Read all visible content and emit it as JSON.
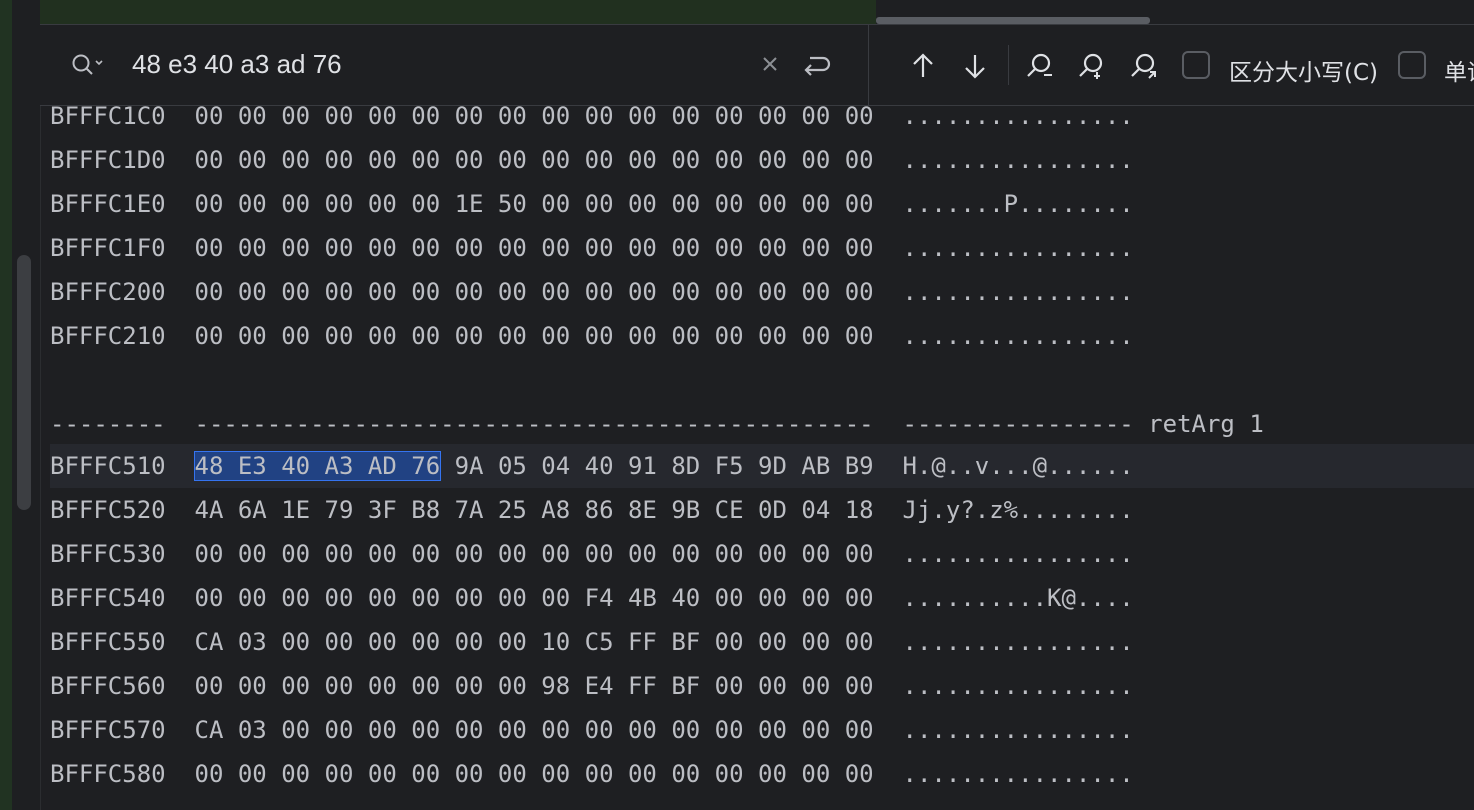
{
  "search": {
    "query": "48 e3 40 a3 ad 76",
    "match_case_label": "区分大小写(C)",
    "words_label": "单词"
  },
  "icons": [
    "search-icon",
    "clear-icon",
    "new-line-icon",
    "arrow-up-icon",
    "arrow-down-icon",
    "filter-icon",
    "select-all-icon",
    "open-in-window-icon"
  ],
  "hex_rows": [
    {
      "addr": "BFFFC1C0",
      "bytes": "00 00 00 00 00 00 00 00 00 00 00 00 00 00 00 00",
      "ascii": "................"
    },
    {
      "addr": "BFFFC1D0",
      "bytes": "00 00 00 00 00 00 00 00 00 00 00 00 00 00 00 00",
      "ascii": "................"
    },
    {
      "addr": "BFFFC1E0",
      "bytes": "00 00 00 00 00 00 1E 50 00 00 00 00 00 00 00 00",
      "ascii": ".......P........"
    },
    {
      "addr": "BFFFC1F0",
      "bytes": "00 00 00 00 00 00 00 00 00 00 00 00 00 00 00 00",
      "ascii": "................"
    },
    {
      "addr": "BFFFC200",
      "bytes": "00 00 00 00 00 00 00 00 00 00 00 00 00 00 00 00",
      "ascii": "................"
    },
    {
      "addr": "BFFFC210",
      "bytes": "00 00 00 00 00 00 00 00 00 00 00 00 00 00 00 00",
      "ascii": "................"
    }
  ],
  "separator": {
    "addr": "--------",
    "bytes": "-----------------------------------------------",
    "ascii": "----------------",
    "label": "retArg 1"
  },
  "highlight": {
    "matched": "48 E3 40 A3 AD 76",
    "rest": " 9A 05 04 40 91 8D F5 9D AB B9"
  },
  "hex_rows2": [
    {
      "addr": "BFFFC510",
      "ascii": "H.@..v...@......"
    },
    {
      "addr": "BFFFC520",
      "bytes": "4A 6A 1E 79 3F B8 7A 25 A8 86 8E 9B CE 0D 04 18",
      "ascii": "Jj.y?.z%........"
    },
    {
      "addr": "BFFFC530",
      "bytes": "00 00 00 00 00 00 00 00 00 00 00 00 00 00 00 00",
      "ascii": "................"
    },
    {
      "addr": "BFFFC540",
      "bytes": "00 00 00 00 00 00 00 00 00 F4 4B 40 00 00 00 00",
      "ascii": "..........K@...."
    },
    {
      "addr": "BFFFC550",
      "bytes": "CA 03 00 00 00 00 00 00 10 C5 FF BF 00 00 00 00",
      "ascii": "................"
    },
    {
      "addr": "BFFFC560",
      "bytes": "00 00 00 00 00 00 00 00 98 E4 FF BF 00 00 00 00",
      "ascii": "................"
    },
    {
      "addr": "BFFFC570",
      "bytes": "CA 03 00 00 00 00 00 00 00 00 00 00 00 00 00 00",
      "ascii": "................"
    },
    {
      "addr": "BFFFC580",
      "bytes": "00 00 00 00 00 00 00 00 00 00 00 00 00 00 00 00",
      "ascii": "................"
    }
  ]
}
